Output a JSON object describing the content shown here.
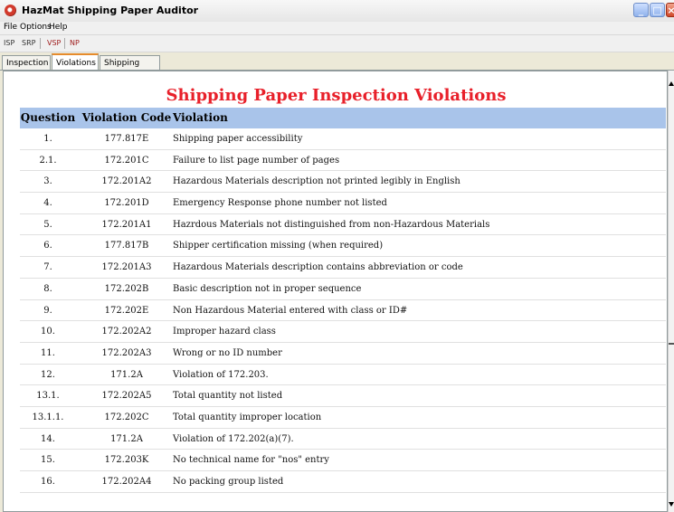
{
  "window": {
    "title": "HazMat Shipping Paper Auditor"
  },
  "menu": [
    "File",
    "Options",
    "Help"
  ],
  "toolbar": {
    "b1": "ISP",
    "b2": "SRP",
    "b3": "VSP",
    "b4": "NP"
  },
  "tabs": [
    "Inspection",
    "Violations",
    "Shipping Paper"
  ],
  "active_tab": "Violations",
  "page": {
    "heading": "Shipping Paper Inspection Violations"
  },
  "table": {
    "headers": [
      "Question",
      "Violation Code",
      "Violation"
    ],
    "header_bg": "#a9c4ea",
    "rows": [
      [
        "1.",
        "177.817E",
        "Shipping paper accessibility"
      ],
      [
        "2.1.",
        "172.201C",
        "Failure to list page number of pages"
      ],
      [
        "3.",
        "172.201A2",
        "Hazardous Materials description not printed legibly in English"
      ],
      [
        "4.",
        "172.201D",
        "Emergency Response phone number not listed"
      ],
      [
        "5.",
        "172.201A1",
        "Hazrdous Materials not distinguished from non-Hazardous Materials"
      ],
      [
        "6.",
        "177.817B",
        "Shipper certification missing (when required)"
      ],
      [
        "7.",
        "172.201A3",
        "Hazardous Materials description contains abbreviation or code"
      ],
      [
        "8.",
        "172.202B",
        "Basic description not in proper sequence"
      ],
      [
        "9.",
        "172.202E",
        "Non Hazardous Material entered with class or ID#"
      ],
      [
        "10.",
        "172.202A2",
        "Improper hazard class"
      ],
      [
        "11.",
        "172.202A3",
        "Wrong or no ID number"
      ],
      [
        "12.",
        "171.2A",
        "Violation of 172.203."
      ],
      [
        "13.1.",
        "172.202A5",
        "Total quantity not listed"
      ],
      [
        "13.1.1.",
        "172.202C",
        "Total quantity improper location"
      ],
      [
        "14.",
        "171.2A",
        "Violation of 172.202(a)(7)."
      ],
      [
        "15.",
        "172.203K",
        "No technical name for \"nos\" entry"
      ],
      [
        "16.",
        "172.202A4",
        "No packing group listed"
      ]
    ]
  },
  "colors": {
    "heading": "#e8202a",
    "active_tab_accent": "#e68b2c"
  }
}
